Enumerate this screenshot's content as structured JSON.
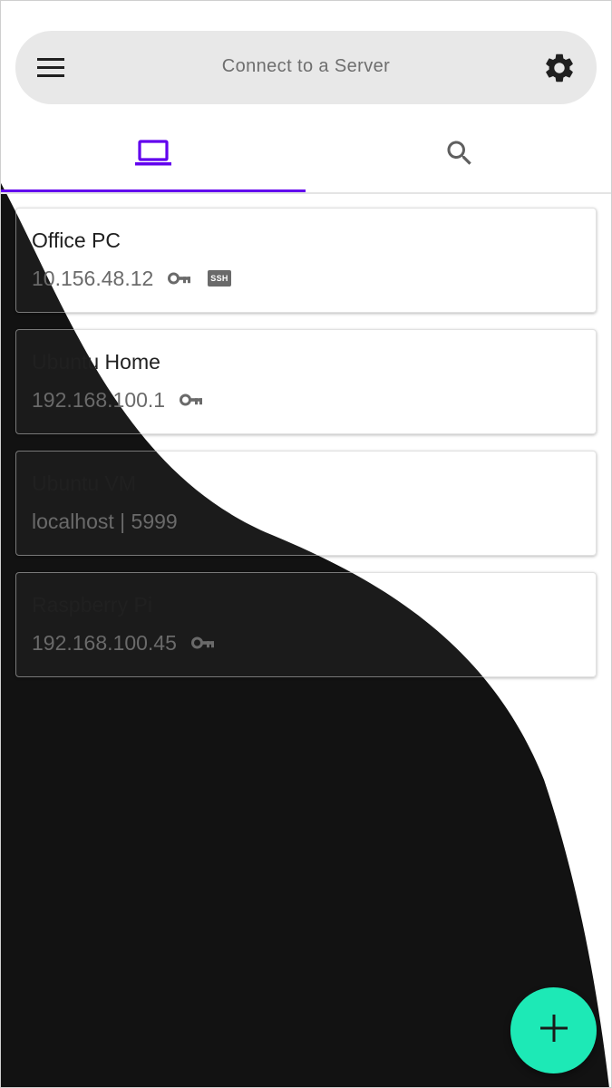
{
  "search_bar": {
    "title": "Connect to a Server",
    "menu_icon": "menu-icon",
    "settings_icon": "gear-icon"
  },
  "tabs": [
    {
      "name": "saved-servers",
      "icon": "laptop-icon",
      "selected": true
    },
    {
      "name": "discovery",
      "icon": "search-icon",
      "selected": false
    }
  ],
  "servers": [
    {
      "name": "Office PC",
      "address": "10.156.48.12",
      "has_key": true,
      "ssh_badge": "SSH"
    },
    {
      "name": "Ubuntu Home",
      "address": "192.168.100.1",
      "has_key": true
    },
    {
      "name": "Ubuntu VM",
      "address": "localhost | 5999"
    },
    {
      "name": "Raspberry Pi",
      "address": "192.168.100.45",
      "has_key": true
    }
  ],
  "fab": {
    "icon": "plus-icon"
  },
  "colors": {
    "accent": "#6200ee",
    "fab": "#1de9b6",
    "search_bar": "#e8e8e8",
    "dark_wave": "#121212"
  }
}
